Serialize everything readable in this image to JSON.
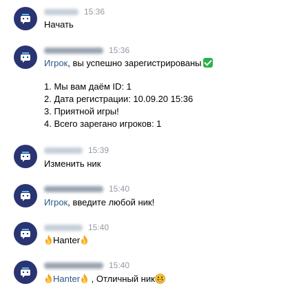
{
  "messages": [
    {
      "time": "15:36",
      "lines": [
        "Начать"
      ]
    },
    {
      "time": "15:36",
      "mention": "Игрок",
      "first_line": ", вы успешно зарегистрированы",
      "lines": [
        "1. Мы вам даём ID: 1",
        "2. Дата регистрации: 10.09.20 15:36",
        "3. Приятной игры!",
        "4. Всего зарегано игроков: 1"
      ]
    },
    {
      "time": "15:39",
      "lines": [
        "Изменить ник"
      ]
    },
    {
      "time": "15:40",
      "mention": "Игрок",
      "first_line": ", введите любой ник!"
    },
    {
      "time": "15:40",
      "nick": "Hanter"
    },
    {
      "time": "15:40",
      "nick": "Hanter",
      "suffix": " , Отличный ник"
    }
  ]
}
